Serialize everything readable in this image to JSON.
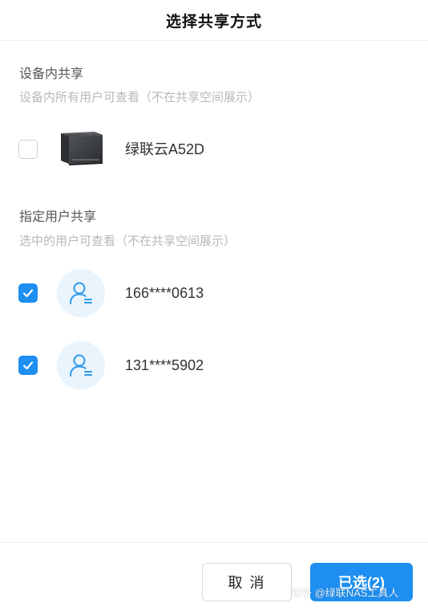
{
  "header": {
    "title": "选择共享方式"
  },
  "device_share": {
    "title": "设备内共享",
    "description": "设备内所有用户可查看（不在共享空间展示）",
    "device": {
      "name": "绿联云A52D",
      "checked": false,
      "icon": "nas-device-icon"
    }
  },
  "user_share": {
    "title": "指定用户共享",
    "description": "选中的用户可查看（不在共享空间展示）",
    "users": [
      {
        "name": "166****0613",
        "checked": true,
        "icon": "user-avatar-icon"
      },
      {
        "name": "131****5902",
        "checked": true,
        "icon": "user-avatar-icon"
      }
    ]
  },
  "footer": {
    "cancel_label": "取 消",
    "confirm_label": "已选(2)"
  },
  "watermark": "知乎 @绿联NAS工具人",
  "colors": {
    "accent": "#1e8ff0",
    "avatar_bg": "#e9f4fd"
  }
}
